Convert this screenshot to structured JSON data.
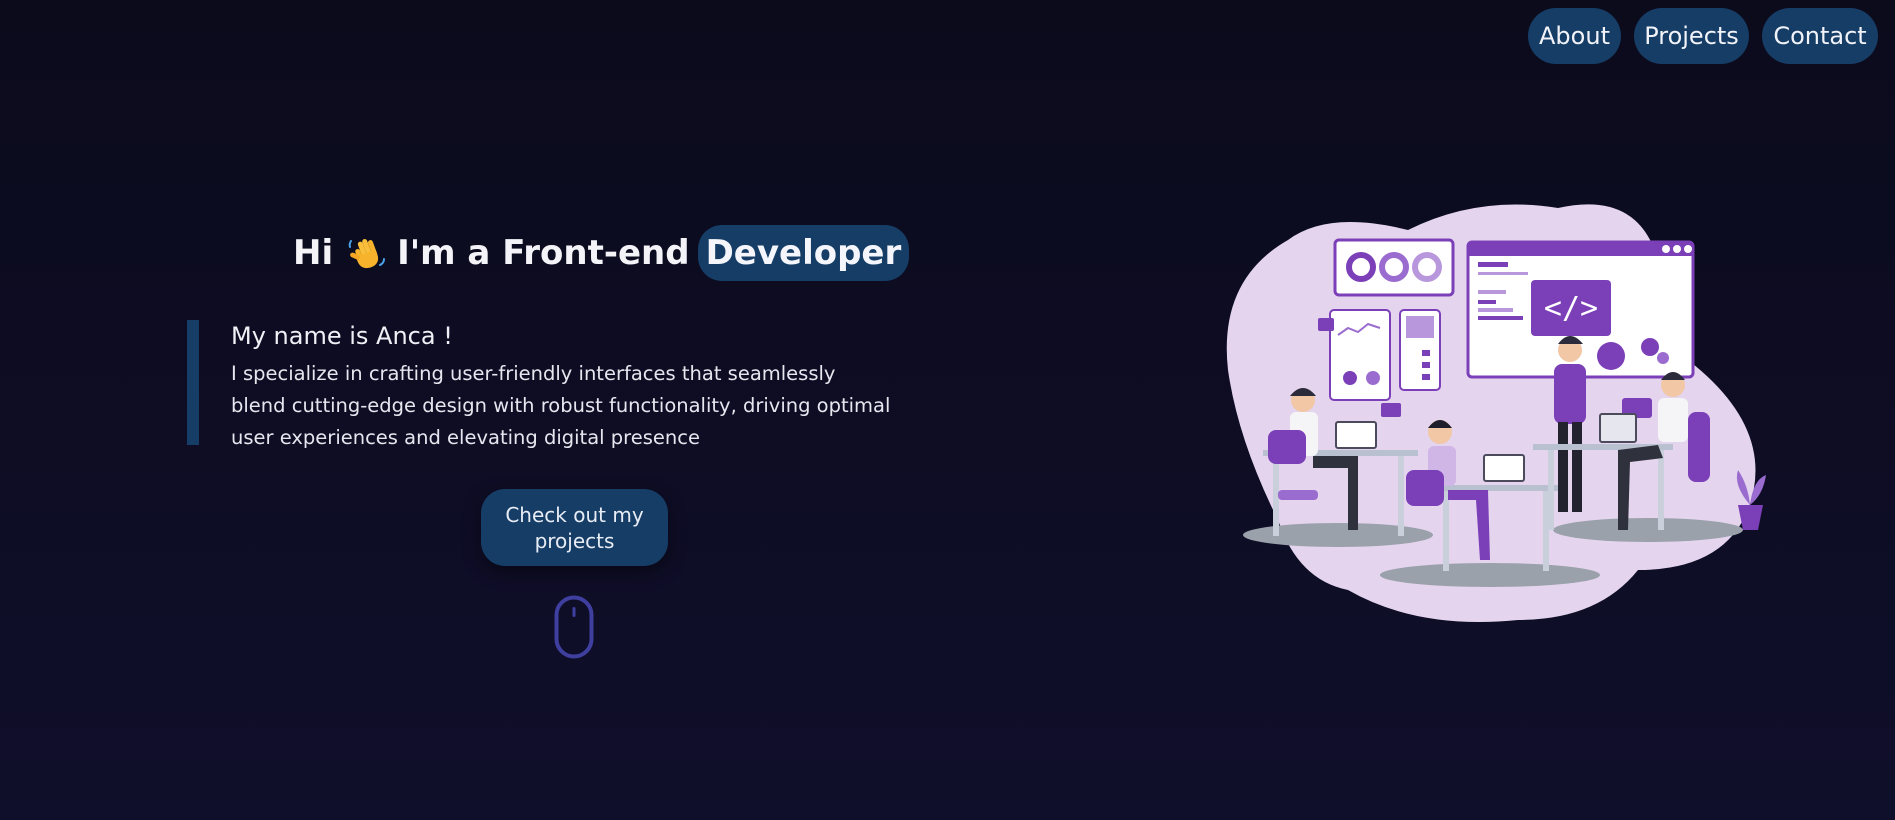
{
  "nav": {
    "items": [
      {
        "label": "About"
      },
      {
        "label": "Projects"
      },
      {
        "label": "Contact"
      }
    ]
  },
  "hero": {
    "greeting": "Hi",
    "wave_icon": "waving-hand-icon",
    "headline": "I'm a Front-end",
    "highlight": "Developer",
    "name": "My name is Anca !",
    "description": "I specialize in crafting user-friendly interfaces that seamlessly blend cutting-edge design with robust functionality, driving optimal user experiences and elevating digital presence",
    "cta_label": "Check out my projects",
    "scroll_icon": "mouse-scroll-icon",
    "illustration_icon": "developer-team-illustration",
    "illustration_code_text": "</>"
  },
  "colors": {
    "background": "#0b0b1c",
    "accent": "#163d66",
    "illustration_purple": "#7b3fb8",
    "illustration_lavender": "#e4d4ee"
  }
}
